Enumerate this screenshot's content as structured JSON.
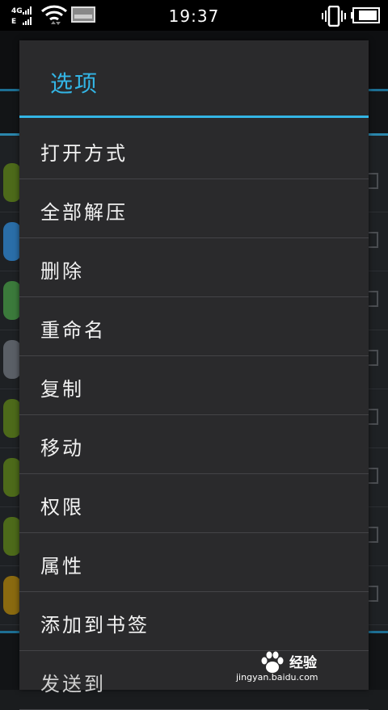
{
  "status_bar": {
    "network_top": "4G",
    "network_bottom": "E",
    "time": "19:37",
    "icons": [
      "signal-icon",
      "wifi-icon",
      "screenshot-icon",
      "vibrate-icon",
      "battery-icon"
    ]
  },
  "dialog": {
    "title": "选项",
    "accent_color": "#33b5e5",
    "items": [
      {
        "label": "打开方式"
      },
      {
        "label": "全部解压"
      },
      {
        "label": "删除"
      },
      {
        "label": "重命名"
      },
      {
        "label": "复制"
      },
      {
        "label": "移动"
      },
      {
        "label": "权限"
      },
      {
        "label": "属性"
      },
      {
        "label": "添加到书签"
      },
      {
        "label": "发送到"
      }
    ]
  },
  "watermark": {
    "brand": "经验",
    "url": "jingyan.baidu.com"
  }
}
